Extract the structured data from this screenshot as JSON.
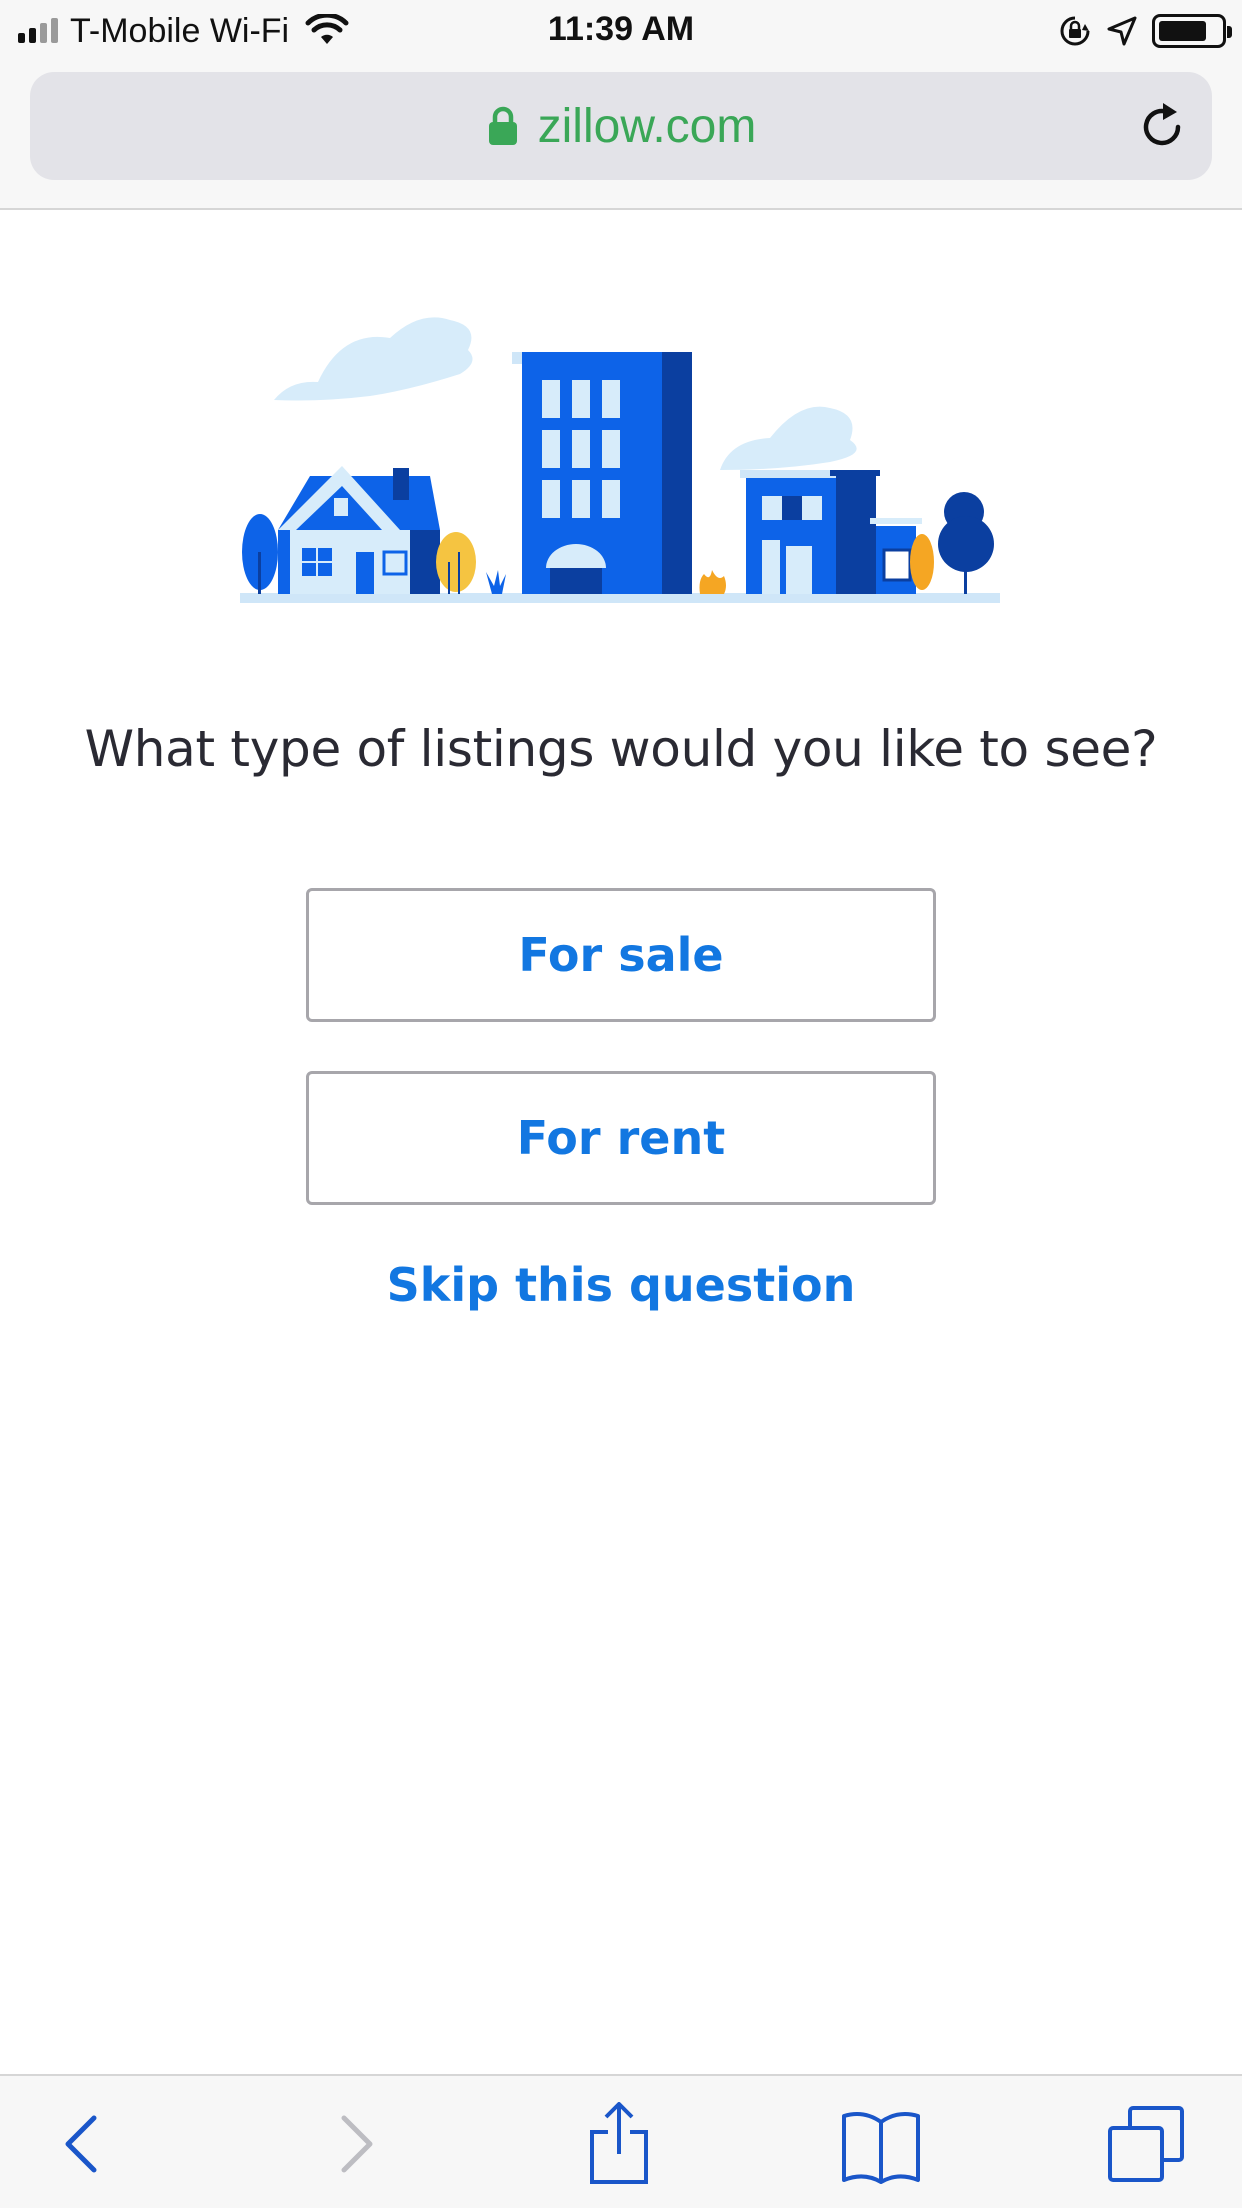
{
  "status_bar": {
    "carrier": "T-Mobile Wi-Fi",
    "time": "11:39 AM",
    "signal_icon": "signal-bars-icon",
    "wifi_icon": "wifi-icon",
    "orientation_lock_icon": "orientation-lock-icon",
    "location_icon": "location-arrow-icon",
    "battery_icon": "battery-icon"
  },
  "browser": {
    "url": "zillow.com",
    "lock_icon": "lock-icon",
    "reload_icon": "reload-icon",
    "url_color": "#3aa757"
  },
  "page": {
    "illustration": "city-buildings-illustration",
    "question": "What type of listings would you like to see?",
    "options": [
      {
        "label": "For sale"
      },
      {
        "label": "For rent"
      }
    ],
    "skip_label": "Skip this question",
    "accent_color": "#1277e1"
  },
  "toolbar": {
    "back_icon": "back-chevron-icon",
    "forward_icon": "forward-chevron-icon",
    "share_icon": "share-icon",
    "bookmarks_icon": "bookmarks-book-icon",
    "tabs_icon": "tabs-icon",
    "icon_color": "#1a56c9"
  }
}
